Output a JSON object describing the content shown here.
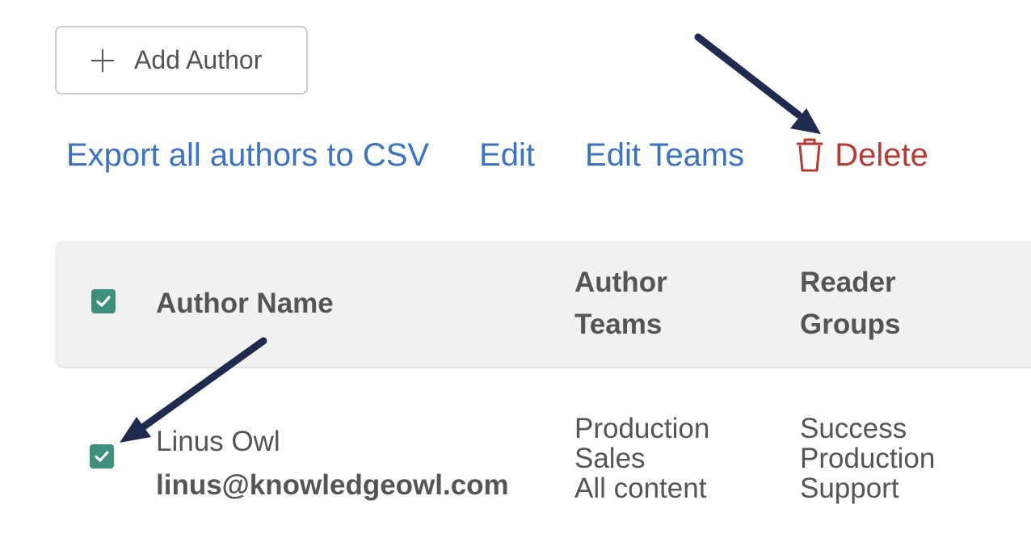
{
  "toolbar": {
    "add_author_label": "Add Author"
  },
  "actions": {
    "export_label": "Export all authors to CSV",
    "edit_label": "Edit",
    "edit_teams_label": "Edit Teams",
    "delete_label": "Delete"
  },
  "table": {
    "header": {
      "name": "Author Name",
      "teams_line1": "Author",
      "teams_line2": "Teams",
      "groups_line1": "Reader",
      "groups_line2": "Groups",
      "select_all_checked": true
    },
    "rows": [
      {
        "checked": true,
        "name": "Linus Owl",
        "email": "linus@knowledgeowl.com",
        "teams": [
          "Production",
          "Sales",
          "All content"
        ],
        "groups": [
          "Success",
          "Production",
          "Support"
        ]
      }
    ]
  },
  "colors": {
    "link": "#3a72c5",
    "danger": "#b53a33",
    "checkbox": "#3f8f7f",
    "annotation_arrow": "#1f2a4f"
  },
  "icons": {
    "add": "plus-icon",
    "delete": "trash-icon",
    "check": "check-icon"
  }
}
